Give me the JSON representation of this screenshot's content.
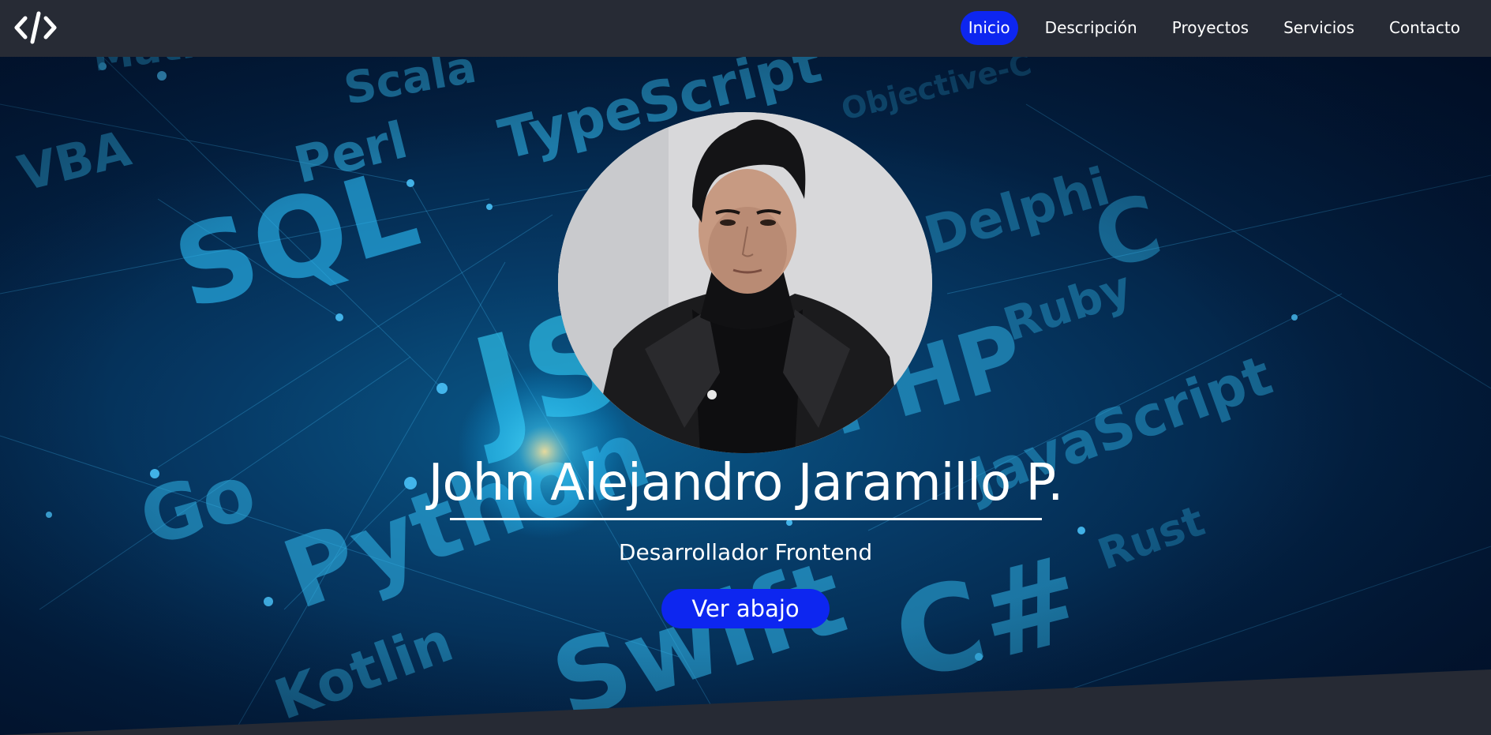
{
  "navbar": {
    "logo_icon": "code-brackets-icon",
    "items": [
      {
        "label": "Inicio",
        "active": true
      },
      {
        "label": "Descripción",
        "active": false
      },
      {
        "label": "Proyectos",
        "active": false
      },
      {
        "label": "Servicios",
        "active": false
      },
      {
        "label": "Contacto",
        "active": false
      }
    ]
  },
  "hero": {
    "name": "John Alejandro Jaramillo P.",
    "subtitle": "Desarrollador Frontend",
    "cta_label": "Ver abajo",
    "background_words": [
      "Matlab",
      "Scala",
      "VBA",
      "Perl",
      "TypeScript",
      "Objective-C",
      "SQL",
      "Delphi",
      "C",
      "Ruby",
      "JS",
      "PHP",
      "JavaScript",
      "Go",
      "Python",
      "Rust",
      "Swift",
      "C#",
      "Kotlin"
    ]
  },
  "colors": {
    "navbar_bg": "#272b35",
    "accent": "#0d26f0",
    "text": "#ffffff",
    "footer_bg": "#262a34"
  }
}
